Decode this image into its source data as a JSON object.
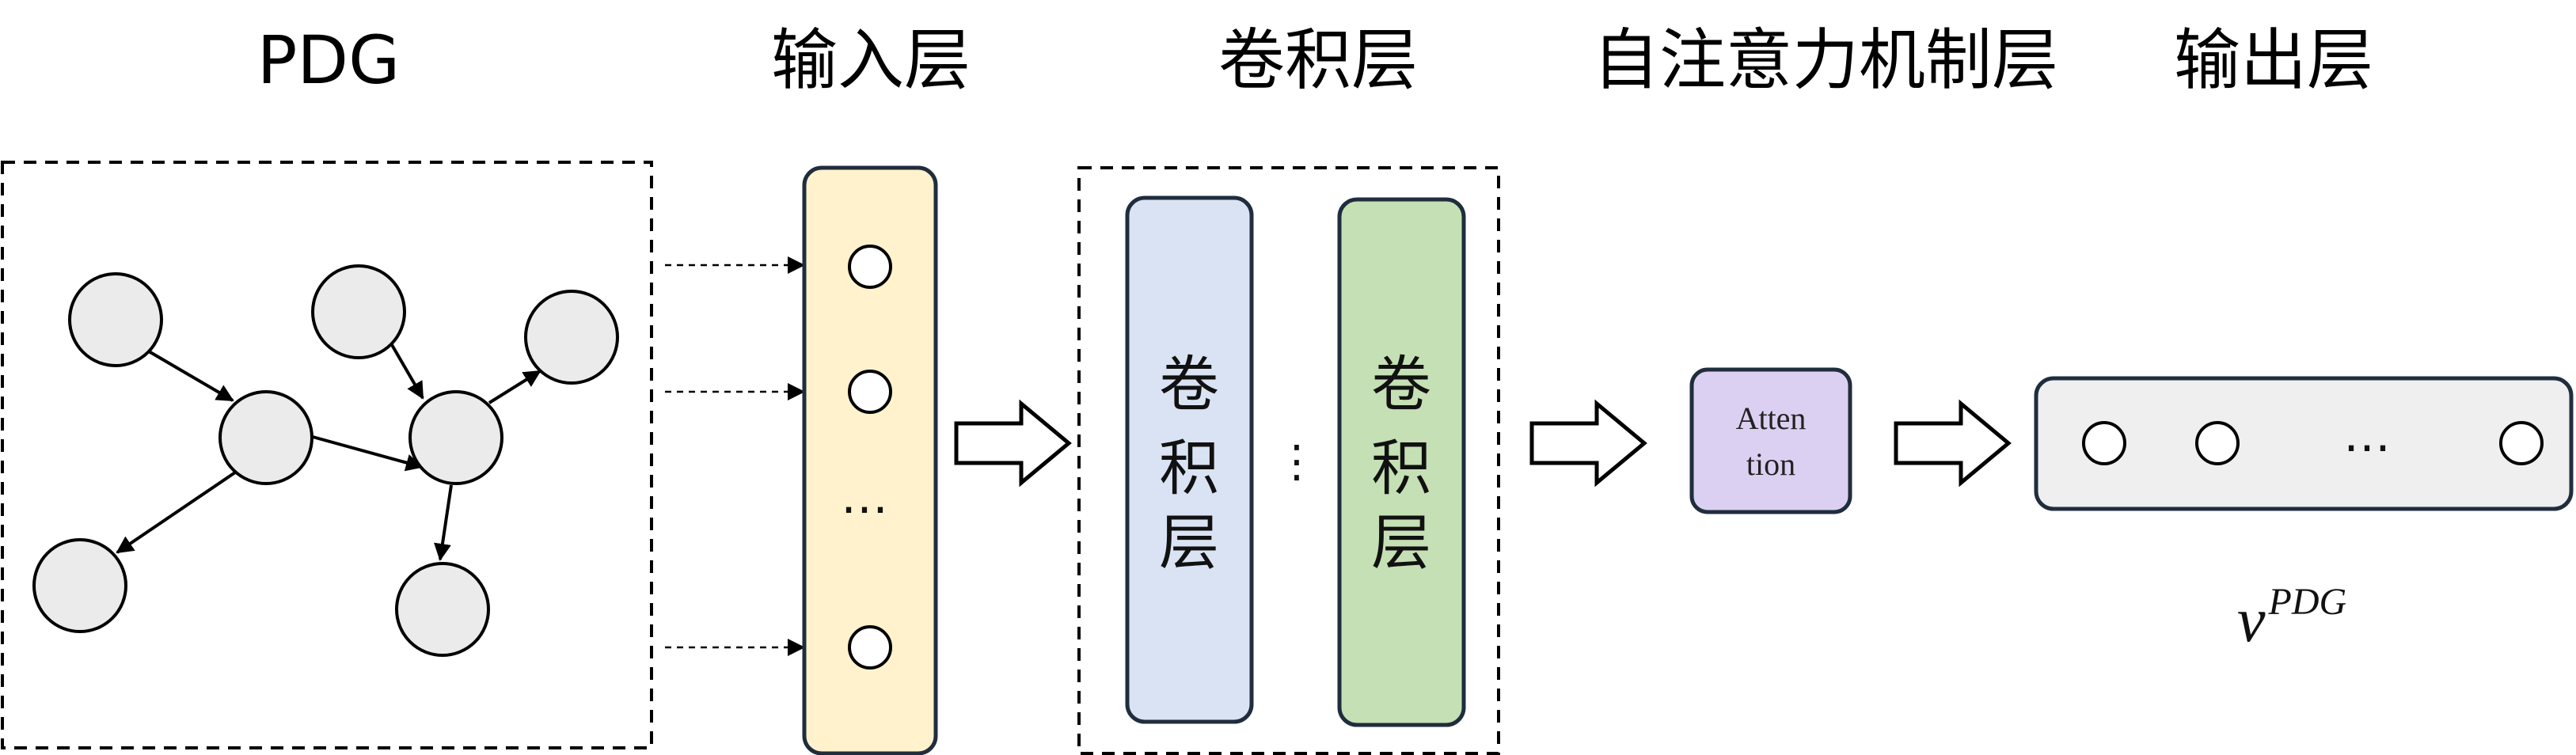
{
  "headers": {
    "pdg": "PDG",
    "input": "输入层",
    "conv": "卷积层",
    "attention": "自注意力机制层",
    "output": "输出层"
  },
  "conv_block_1": [
    "卷",
    "积",
    "层"
  ],
  "conv_block_2": [
    "卷",
    "积",
    "层"
  ],
  "conv_gap_dots": "⋮",
  "input_ellipsis": "…",
  "output_ellipsis": "…",
  "attention_box": {
    "line1": "Atten",
    "line2": "tion"
  },
  "output_vector": {
    "base": "v",
    "superscript": "PDG"
  },
  "colors": {
    "node_fill": "#ebebeb",
    "input_layer_fill": "#fff2cc",
    "conv1_fill": "#dae3f3",
    "conv2_fill": "#c5e0b4",
    "attention_fill": "#dcd0f2",
    "output_fill": "#efefef",
    "border": "#1f2d3d"
  }
}
